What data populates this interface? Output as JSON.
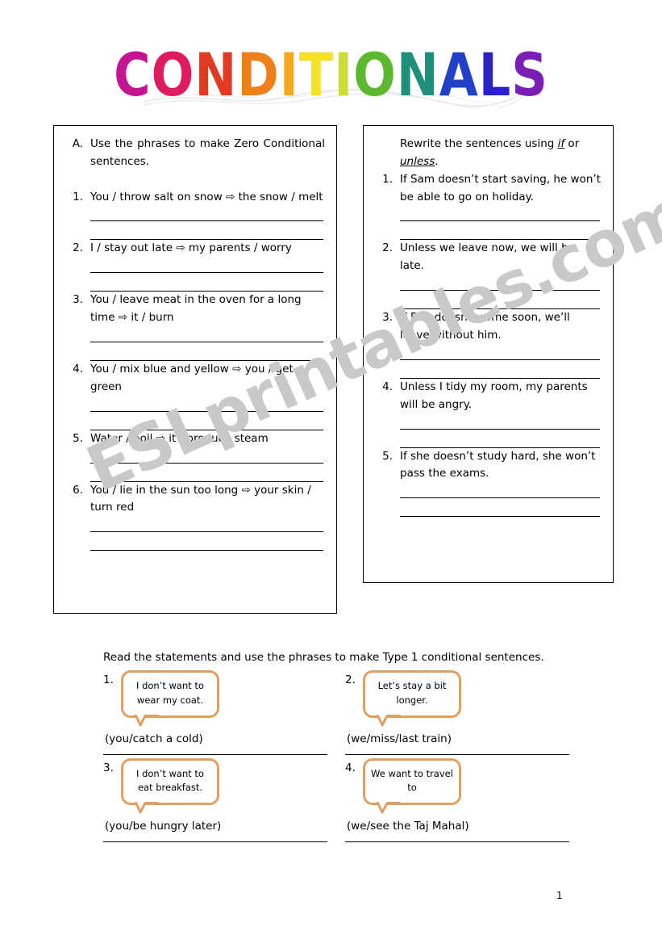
{
  "title": {
    "text": "CONDITIONALS",
    "letters": [
      {
        "ch": "C",
        "color": "#c2158f"
      },
      {
        "ch": "O",
        "color": "#e01b5d"
      },
      {
        "ch": "N",
        "color": "#e23a20"
      },
      {
        "ch": "D",
        "color": "#ef7f1a"
      },
      {
        "ch": "I",
        "color": "#f5a623"
      },
      {
        "ch": "T",
        "color": "#f5e02a"
      },
      {
        "ch": "I",
        "color": "#cddc39"
      },
      {
        "ch": "O",
        "color": "#5cb82e"
      },
      {
        "ch": "N",
        "color": "#1e8f7a"
      },
      {
        "ch": "A",
        "color": "#2340c8"
      },
      {
        "ch": "L",
        "color": "#2b22c4"
      },
      {
        "ch": "S",
        "color": "#7a1fb5"
      }
    ]
  },
  "watermark": {
    "text": "ESLprintables.com",
    "color": "#c9c9c9"
  },
  "exercise_a": {
    "label": "A.",
    "instruction": "Use the phrases to make Zero Conditional sentences.",
    "arrow": "⇨",
    "items": [
      {
        "num": "1.",
        "text": "You / throw salt on snow ⇨ the snow / melt",
        "lines": 2
      },
      {
        "num": "2.",
        "text": "I / stay out late ⇨ my parents / worry",
        "lines": 2
      },
      {
        "num": "3.",
        "text": "You / leave meat in the oven for a long time ⇨ it / burn",
        "lines": 2
      },
      {
        "num": "4.",
        "text": "You / mix blue and yellow ⇨ you / get green",
        "lines": 2
      },
      {
        "num": "5.",
        "text": "Water / boil ⇨ it / produce steam",
        "lines": 2
      },
      {
        "num": "6.",
        "text": "You / lie in the sun too long ⇨ your skin / turn red",
        "lines": 2
      }
    ]
  },
  "exercise_b": {
    "instruction_pre": "Rewrite the sentences using ",
    "keyword_1": "if",
    "instruction_mid": " or ",
    "keyword_2": "unless",
    "instruction_post": ".",
    "items": [
      {
        "num": "1.",
        "text": "If Sam doesn’t start saving, he won’t be able to go on holiday.",
        "lines": 2
      },
      {
        "num": "2.",
        "text": "Unless we leave now, we will be late.",
        "lines": 2
      },
      {
        "num": "3.",
        "text": "If Ron doesn’t come soon, we’ll leave without him.",
        "lines": 2
      },
      {
        "num": "4.",
        "text": "Unless I tidy my room, my parents will be angry.",
        "lines": 2
      },
      {
        "num": "5.",
        "text": "If she doesn’t study hard, she won’t pass the exams.",
        "lines": 2
      }
    ]
  },
  "exercise_c": {
    "instruction": "Read the statements and use the phrases to make Type 1 conditional sentences.",
    "bubble_border_color": "#e0a063",
    "items": [
      {
        "num": "1.",
        "bubble": "I don’t want to wear my coat.",
        "phrase": "(you/catch a cold)"
      },
      {
        "num": "2.",
        "bubble": "Let’s stay a bit longer.",
        "phrase": "(we/miss/last train)"
      },
      {
        "num": "3.",
        "bubble": "I don’t want to eat breakfast.",
        "phrase": "(you/be hungry later)"
      },
      {
        "num": "4.",
        "bubble": "We want to travel to",
        "phrase": "(we/see the Taj Mahal)"
      }
    ]
  },
  "page_number": "1"
}
